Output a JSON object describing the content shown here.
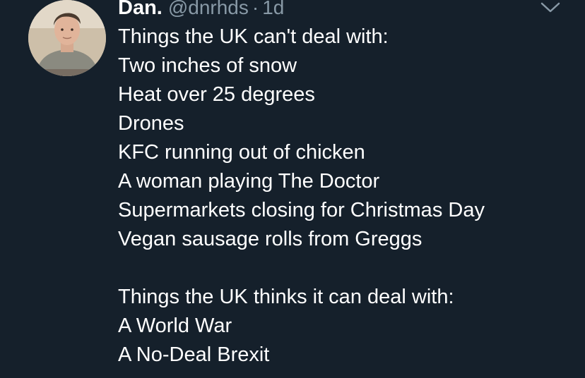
{
  "tweet": {
    "author": {
      "display_name": "Dan.",
      "handle": "@dnrhds",
      "separator": "·",
      "time": "1d",
      "avatar_icon": "profile-photo"
    },
    "menu_icon": "chevron-down-icon",
    "paragraph1": [
      "Things the UK can't deal with:",
      "Two inches of snow",
      "Heat over 25 degrees",
      "Drones",
      "KFC running out of chicken",
      "A woman playing The Doctor",
      "Supermarkets closing for Christmas Day",
      "Vegan sausage rolls from Greggs"
    ],
    "paragraph2": [
      "Things the UK thinks it can deal with:",
      "A World War",
      "A No-Deal Brexit"
    ]
  },
  "colors": {
    "background": "#15202b",
    "text": "#ffffff",
    "secondary_text": "#8899a6"
  }
}
